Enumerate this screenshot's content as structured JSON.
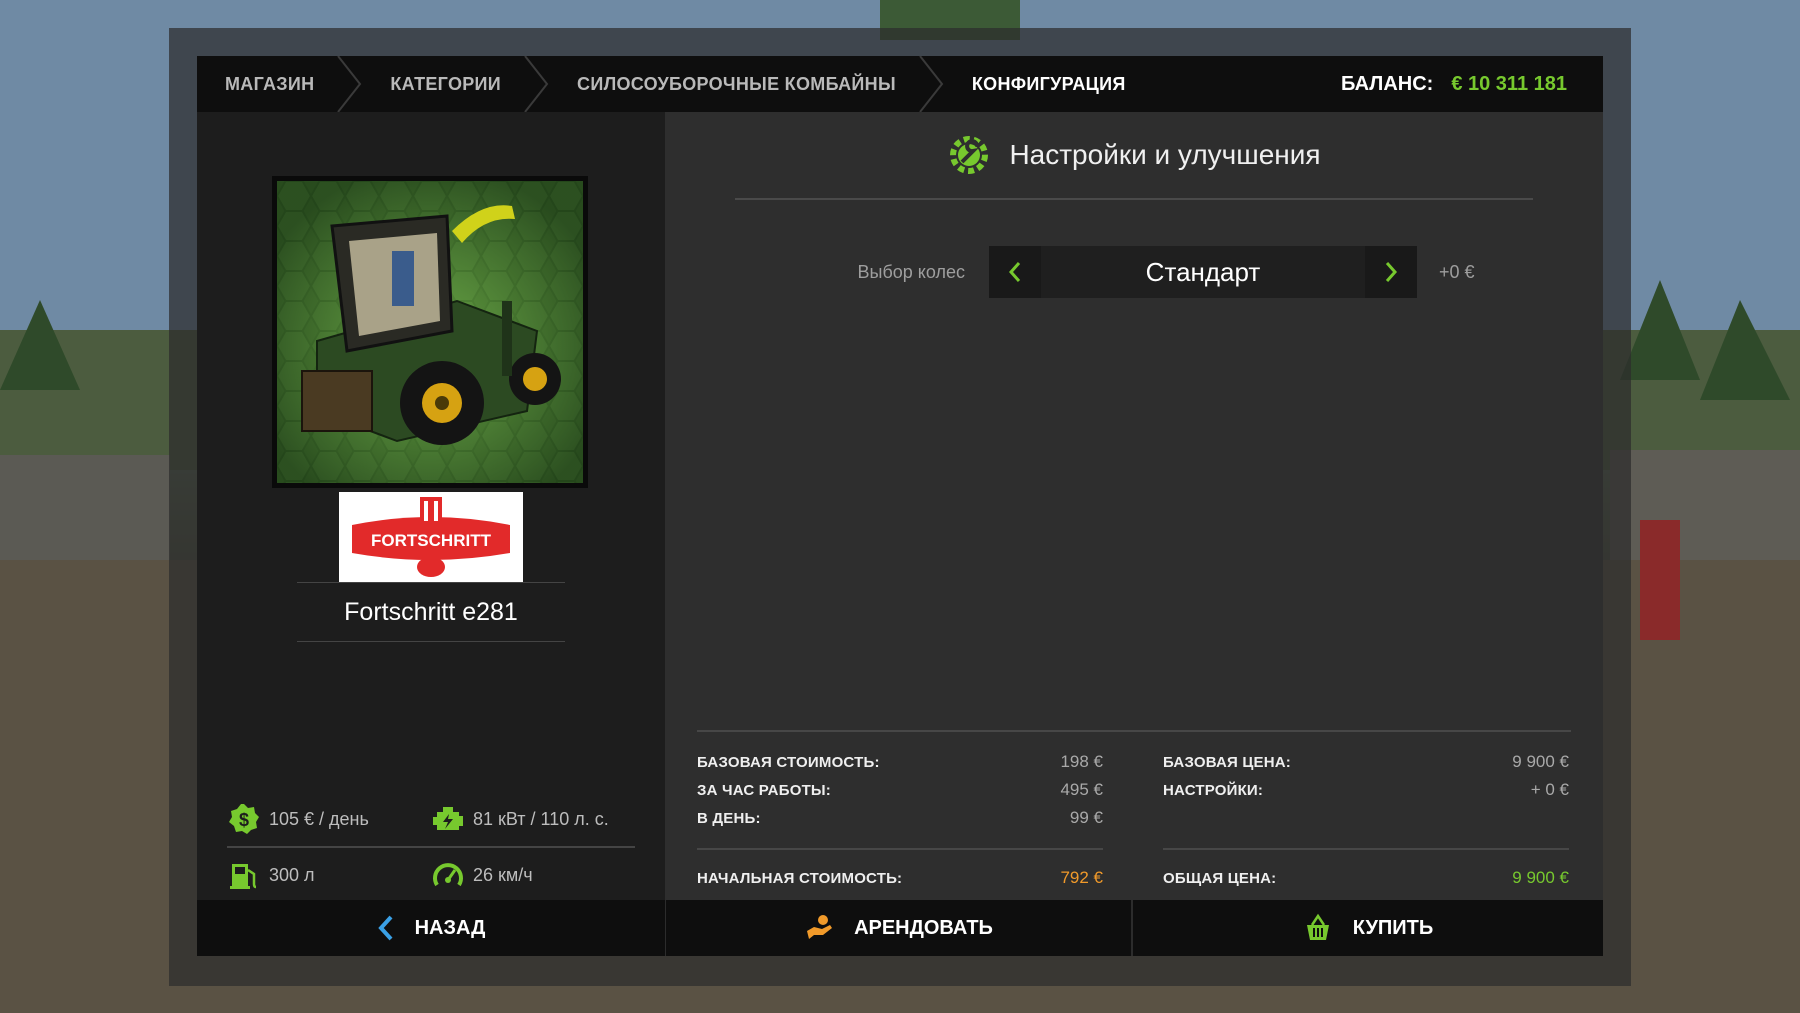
{
  "breadcrumbs": [
    {
      "label": "МАГАЗИН"
    },
    {
      "label": "КАТЕГОРИИ"
    },
    {
      "label": "СИЛОСОУБОРОЧНЫЕ КОМБАЙНЫ"
    },
    {
      "label": "КОНФИГУРАЦИЯ"
    }
  ],
  "balance": {
    "label": "БАЛАНС:",
    "value": "€ 10 311 181"
  },
  "vehicle": {
    "brand_logo_text": "FORTSCHRITT",
    "name": "Fortschritt e281"
  },
  "specs": {
    "cost_per_day": "105 € / день",
    "power": "81 кВт / 110 л. с.",
    "fuel_capacity": "300 л",
    "max_speed": "26 км/ч"
  },
  "section": {
    "title": "Настройки и улучшения"
  },
  "config": {
    "wheels": {
      "label": "Выбор колес",
      "value": "Стандарт",
      "price": "+0 €"
    }
  },
  "summary": {
    "base_cost": {
      "label": "БАЗОВАЯ СТОИМОСТЬ:",
      "value": "198 €"
    },
    "per_hour": {
      "label": "ЗА ЧАС РАБОТЫ:",
      "value": "495 €"
    },
    "per_day": {
      "label": "В ДЕНЬ:",
      "value": "99 €"
    },
    "initial_cost": {
      "label": "НАЧАЛЬНАЯ СТОИМОСТЬ:",
      "value": "792 €"
    },
    "base_price": {
      "label": "БАЗОВАЯ ЦЕНА:",
      "value": "9 900 €"
    },
    "settings": {
      "label": "НАСТРОЙКИ:",
      "value": "+ 0 €"
    },
    "total_price": {
      "label": "ОБЩАЯ ЦЕНА:",
      "value": "9 900 €"
    }
  },
  "buttons": {
    "back": "НАЗАД",
    "rent": "АРЕНДОВАТЬ",
    "buy": "КУПИТЬ"
  },
  "colors": {
    "accent_green": "#77c92e",
    "accent_orange": "#f19a2a",
    "accent_blue": "#3aa0e6"
  }
}
